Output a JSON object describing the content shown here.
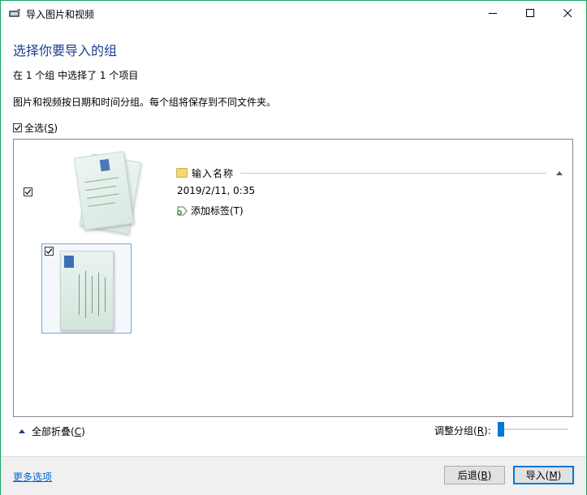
{
  "window": {
    "title": "导入图片和视频",
    "controls": {
      "minimize": "minimize",
      "maximize": "maximize",
      "close": "close"
    }
  },
  "heading": "选择你要导入的组",
  "selection_summary": "在 1 个组 中选择了 1 个项目",
  "description": "图片和视频按日期和时间分组。每个组将保存到不同文件夹。",
  "select_all": {
    "label": "全选(",
    "mnemonic": "S",
    "suffix": ")",
    "checked": true
  },
  "group": {
    "checked": true,
    "folder_name": "输入名称",
    "date": "2019/2/11, 0:35",
    "add_tag": "添加标签(T)",
    "items": [
      {
        "checked": true
      }
    ]
  },
  "collapse_all": {
    "label": "全部折叠(",
    "mnemonic": "C",
    "suffix": ")"
  },
  "adjust_groups": {
    "label": "调整分组(",
    "mnemonic": "R",
    "suffix": "):",
    "slider_fraction": 0.0
  },
  "footer": {
    "more_options": "更多选项",
    "back": {
      "label": "后退(",
      "mnemonic": "B",
      "suffix": ")"
    },
    "import": {
      "label": "导入(",
      "mnemonic": "M",
      "suffix": ")"
    }
  },
  "colors": {
    "accent": "#0078d7",
    "heading": "#1d3f8f",
    "link": "#0066cc",
    "border": "#1aa260"
  },
  "icons": [
    "import-device-icon",
    "minimize-icon",
    "maximize-icon",
    "close-icon",
    "folder-icon",
    "caret-up-icon",
    "tag-add-icon",
    "checkbox-check-icon"
  ]
}
